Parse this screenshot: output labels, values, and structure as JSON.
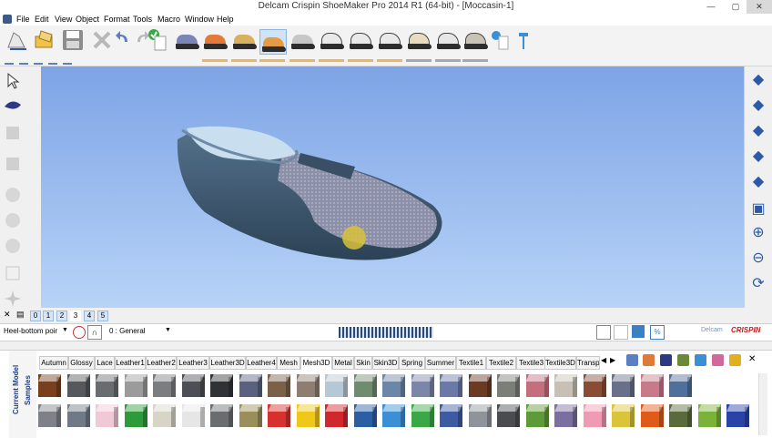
{
  "window": {
    "title": "Delcam Crispin ShoeMaker Pro 2014 R1 (64-bit) - [Moccasin-1]",
    "controls": [
      "—",
      "▢",
      "✕"
    ]
  },
  "menu": [
    "File",
    "Edit",
    "View",
    "Object",
    "Format",
    "Tools",
    "Macro",
    "Window",
    "Help"
  ],
  "toolbar": {
    "shoes": [
      {
        "id": "shoe-1",
        "upper": "#7a86b8"
      },
      {
        "id": "shoe-2",
        "upper": "#e37a3a"
      },
      {
        "id": "shoe-3",
        "upper": "#d7b25e"
      },
      {
        "id": "shoe-4",
        "upper": "#e59b45"
      },
      {
        "id": "shoe-5",
        "upper": "#c7c7c7"
      },
      {
        "id": "shoe-6",
        "upper": "#e9e9e9"
      },
      {
        "id": "shoe-7",
        "upper": "#e9e9e9"
      },
      {
        "id": "shoe-8",
        "upper": "#e9e9e9"
      },
      {
        "id": "shoe-9",
        "upper": "#e8dcbf"
      },
      {
        "id": "shoe-10",
        "upper": "#e6e6e6"
      },
      {
        "id": "shoe-11",
        "upper": "#c9c3b5"
      }
    ],
    "selected_shoe": 3
  },
  "layers": {
    "tabs": [
      "0",
      "1",
      "2",
      "3",
      "4",
      "5"
    ],
    "active": "3"
  },
  "properties": {
    "part_select": "Heel-bottom poir",
    "layer_select": "0  : General",
    "brand": "CRISPIN",
    "brand_prefix": "Delcam"
  },
  "materials": {
    "side_tabs": [
      "Current Model",
      "Samples"
    ],
    "tabs": [
      "Autumn",
      "Glossy",
      "Lace",
      "Leather1",
      "Leather2",
      "Leather3",
      "Leather3D",
      "Leather4",
      "Mesh",
      "Mesh3D",
      "Metal",
      "Skin",
      "Skin3D",
      "Spring",
      "Summer",
      "Textile1",
      "Textile2",
      "Textile3",
      "Textile3D",
      "Transp"
    ],
    "active_tab": "Mesh3D",
    "row1": [
      "#7a3f1c",
      "#55585c",
      "#6a6d70",
      "#9b9b9b",
      "#7b7d80",
      "#4c4f55",
      "#2f3338",
      "#5a6280",
      "#7a6148",
      "#8d7d72",
      "#b6c7d6",
      "#6f8c6e",
      "#6b86a9",
      "#7c86a8",
      "#6b79a8",
      "#6b3a22",
      "#7a7f78",
      "#c4707c",
      "#c8c0b4",
      "#8a4c34",
      "#6a6f8a",
      "#c97a8a",
      "#4f6f9c"
    ],
    "row2": [
      "#7e8288",
      "#6f7a86",
      "#f1c8d6",
      "#2f9a3a",
      "#d8d5c8",
      "#e6e6e6",
      "#6a6d70",
      "#9a8f5a",
      "#d8302c",
      "#f0c81a",
      "#d1282e",
      "#2c5ea3",
      "#3b8fd4",
      "#3aa846",
      "#3e5aa0",
      "#8f949a",
      "#4a4c50",
      "#5f9a38",
      "#7a6fa0",
      "#f09ab4",
      "#d9c43a",
      "#e05a1a",
      "#5a6a3a",
      "#7ab23a",
      "#2a43a8"
    ]
  }
}
